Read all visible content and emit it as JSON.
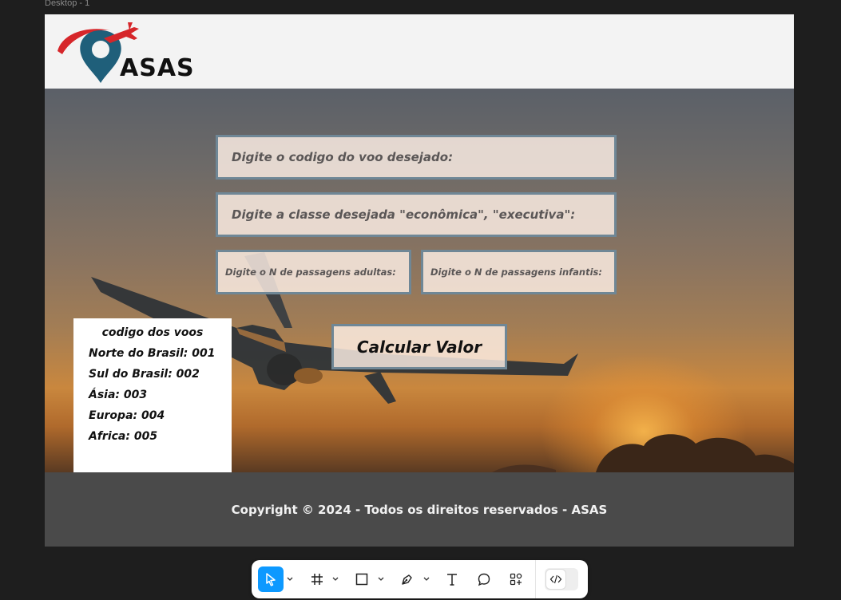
{
  "canvas": {
    "frame_label": "Desktop - 1"
  },
  "header": {
    "logo_text": "ASAS"
  },
  "form": {
    "flight_code_label": "Digite o codigo do voo desejado:",
    "class_label": "Digite a classe desejada \"econômica\", \"executiva\":",
    "adults_label": "Digite o N de passagens adultas:",
    "children_label": "Digite o N de passagens infantis:",
    "calculate_button": "Calcular Valor"
  },
  "flight_codes": {
    "title": "codigo dos voos",
    "items": [
      "Norte do Brasil: 001",
      "Sul do Brasil: 002",
      "Ásia: 003",
      "Europa: 004",
      "Africa: 005"
    ]
  },
  "footer": {
    "copyright": "Copyright © 2024 - Todos os direitos reservados - ASAS"
  },
  "toolbar": {
    "tools": [
      "move-tool",
      "frame-tool",
      "rectangle-tool",
      "pen-tool",
      "text-tool",
      "comment-tool",
      "components-tool",
      "dev-mode-toggle"
    ]
  },
  "colors": {
    "accent": "#0d99ff",
    "logo_red": "#d6262a",
    "logo_teal": "#1f5f7a",
    "input_border": "#6f8796",
    "footer_bg": "#4a4a4a"
  }
}
